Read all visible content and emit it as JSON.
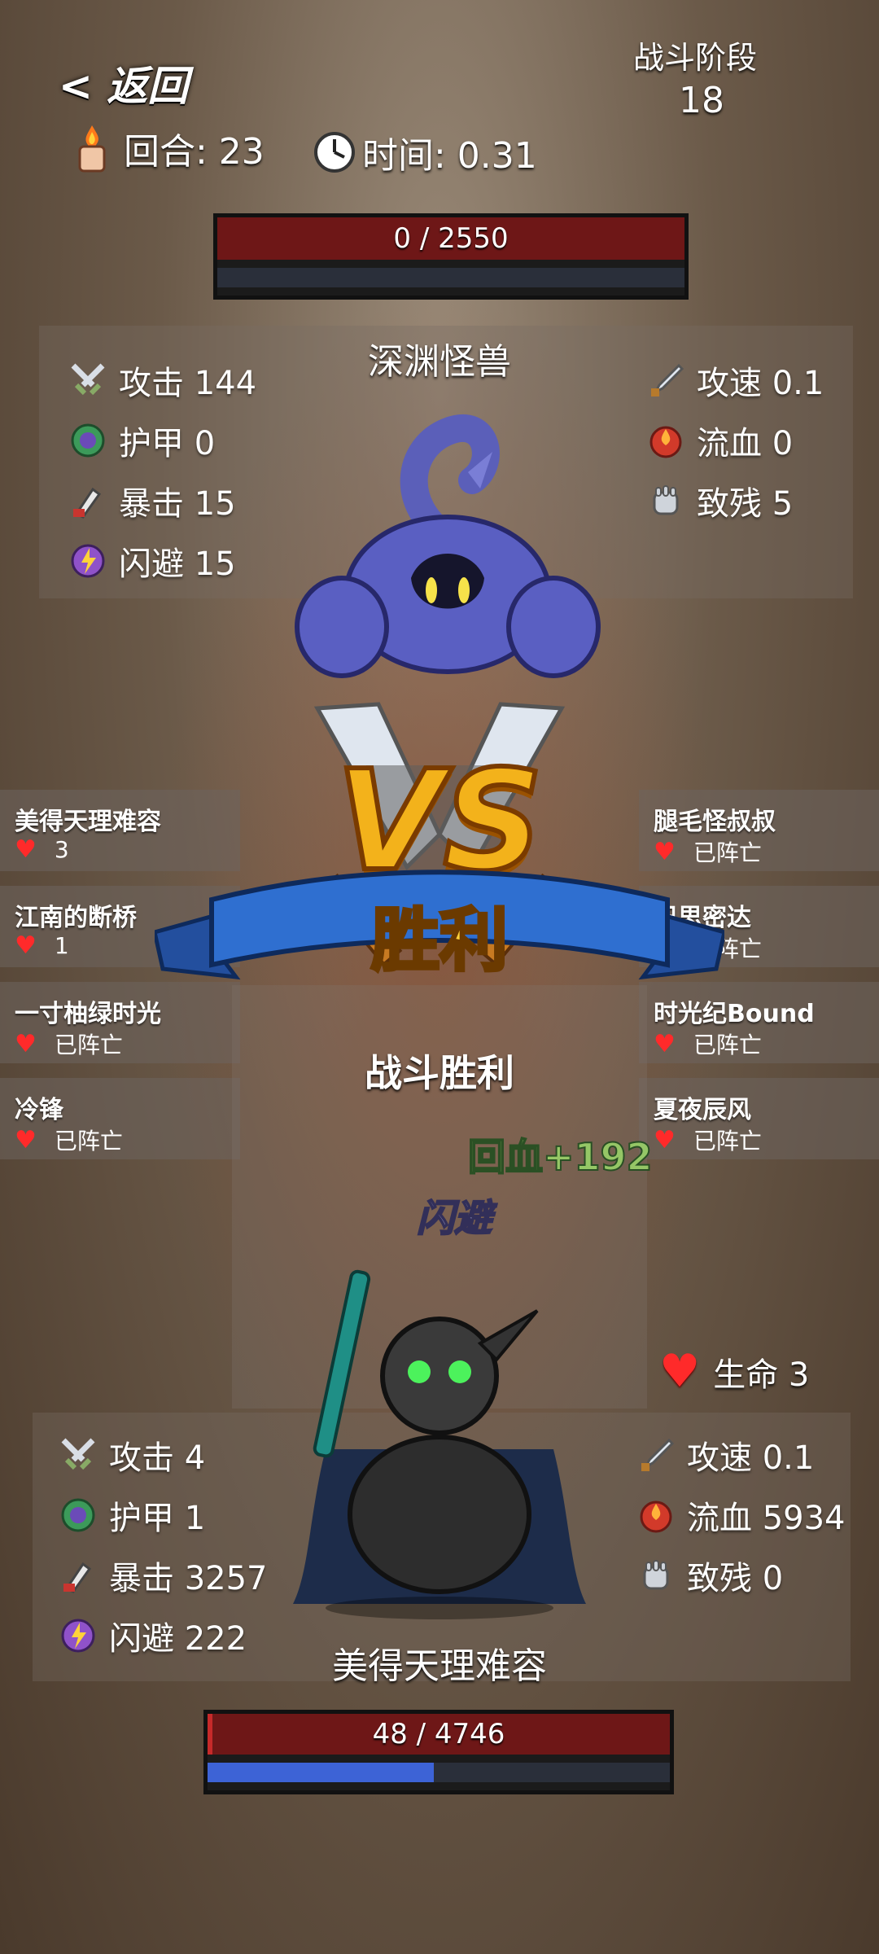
{
  "header": {
    "back_label": "< 返回",
    "round_label": "回合: 23",
    "time_label": "时间: 0.31",
    "stage_label": "战斗阶段",
    "stage_value": "18"
  },
  "enemy": {
    "hp_text": "0 / 2550",
    "hp_fraction": 0.0,
    "name": "深渊怪兽",
    "stats_left": [
      {
        "icon": "sword-icon",
        "label": "攻击 144"
      },
      {
        "icon": "armor-icon",
        "label": "护甲 0"
      },
      {
        "icon": "crit-icon",
        "label": "暴击 15"
      },
      {
        "icon": "dodge-icon",
        "label": "闪避 15"
      }
    ],
    "stats_right": [
      {
        "icon": "attack-speed-icon",
        "label": "攻速 0.1"
      },
      {
        "icon": "bleed-icon",
        "label": "流血 0"
      },
      {
        "icon": "cripple-icon",
        "label": "致残 5"
      }
    ]
  },
  "team_left": [
    {
      "name": "美得天理难容",
      "status": "3"
    },
    {
      "name": "江南的断桥",
      "status": "1"
    },
    {
      "name": "一寸柚绿时光",
      "status": "已阵亡"
    },
    {
      "name": "冷锋",
      "status": "已阵亡"
    }
  ],
  "team_right": [
    {
      "name": "腿毛怪叔叔",
      "status": "已阵亡"
    },
    {
      "name": "巴思密达",
      "status": "已阵亡"
    },
    {
      "name": "时光纪Bound",
      "status": "已阵亡"
    },
    {
      "name": "夏夜辰风",
      "status": "已阵亡"
    }
  ],
  "battle": {
    "vs_text": "VS",
    "result_banner": "胜利",
    "result_text": "战斗胜利",
    "float_heal": "回血+192",
    "float_dodge": "闪避"
  },
  "player": {
    "life_label": "生命 3",
    "name": "美得天理难容",
    "hp_text": "48 / 4746",
    "hp_fraction": 0.01,
    "mana_fraction": 0.49,
    "stats_left": [
      {
        "icon": "sword-icon",
        "label": "攻击 4"
      },
      {
        "icon": "armor-icon",
        "label": "护甲 1"
      },
      {
        "icon": "crit-icon",
        "label": "暴击 3257"
      },
      {
        "icon": "dodge-icon",
        "label": "闪避 222"
      }
    ],
    "stats_right": [
      {
        "icon": "attack-speed-icon",
        "label": "攻速 0.1"
      },
      {
        "icon": "bleed-icon",
        "label": "流血 5934"
      },
      {
        "icon": "cripple-icon",
        "label": "致残 0"
      }
    ]
  },
  "colors": {
    "hp_red": "#7a1a1a",
    "mana_blue": "#3d63d6",
    "banner_blue": "#2f6fd0",
    "vs_gold": "#f3b21b"
  }
}
